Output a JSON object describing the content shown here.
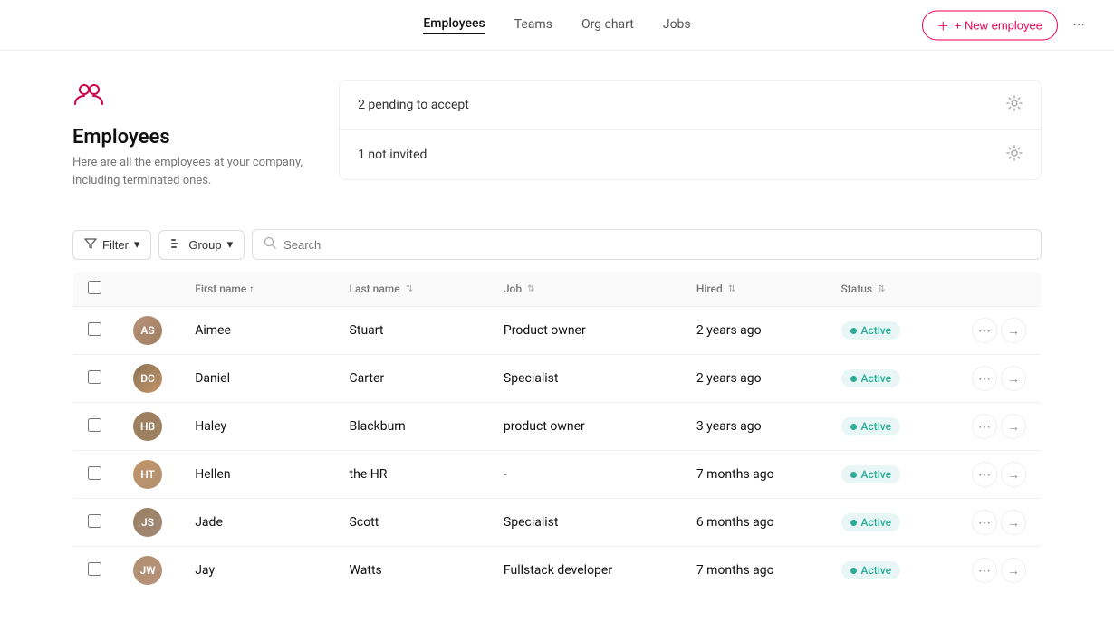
{
  "nav": {
    "links": [
      {
        "id": "employees",
        "label": "Employees",
        "active": true
      },
      {
        "id": "teams",
        "label": "Teams",
        "active": false
      },
      {
        "id": "org-chart",
        "label": "Org chart",
        "active": false
      },
      {
        "id": "jobs",
        "label": "Jobs",
        "active": false
      }
    ],
    "new_employee_label": "+ New employee",
    "more_icon": "⋯"
  },
  "page": {
    "icon": "👥",
    "title": "Employees",
    "subtitle": "Here are all the employees at your company,\nincluding terminated ones."
  },
  "info_cards": [
    {
      "text": "2 pending to accept"
    },
    {
      "text": "1 not invited"
    }
  ],
  "controls": {
    "filter_label": "Filter",
    "group_label": "Group",
    "search_placeholder": "Search"
  },
  "table": {
    "columns": [
      {
        "id": "first_name",
        "label": "First name",
        "sortable": true
      },
      {
        "id": "last_name",
        "label": "Last name",
        "sortable": true
      },
      {
        "id": "job",
        "label": "Job",
        "sortable": true
      },
      {
        "id": "hired",
        "label": "Hired",
        "sortable": true
      },
      {
        "id": "status",
        "label": "Status",
        "sortable": true
      }
    ],
    "rows": [
      {
        "id": 1,
        "first_name": "Aimee",
        "last_name": "Stuart",
        "job": "Product owner",
        "hired": "2 years ago",
        "status": "Active",
        "av": "av1"
      },
      {
        "id": 2,
        "first_name": "Daniel",
        "last_name": "Carter",
        "job": "Specialist",
        "hired": "2 years ago",
        "status": "Active",
        "av": "av2"
      },
      {
        "id": 3,
        "first_name": "Haley",
        "last_name": "Blackburn",
        "job": "product owner",
        "hired": "3 years ago",
        "status": "Active",
        "av": "av3"
      },
      {
        "id": 4,
        "first_name": "Hellen",
        "last_name": "the HR",
        "job": "-",
        "hired": "7 months ago",
        "status": "Active",
        "av": "av4"
      },
      {
        "id": 5,
        "first_name": "Jade",
        "last_name": "Scott",
        "job": "Specialist",
        "hired": "6 months ago",
        "status": "Active",
        "av": "av5"
      },
      {
        "id": 6,
        "first_name": "Jay",
        "last_name": "Watts",
        "job": "Fullstack developer",
        "hired": "7 months ago",
        "status": "Active",
        "av": "av6"
      }
    ]
  }
}
